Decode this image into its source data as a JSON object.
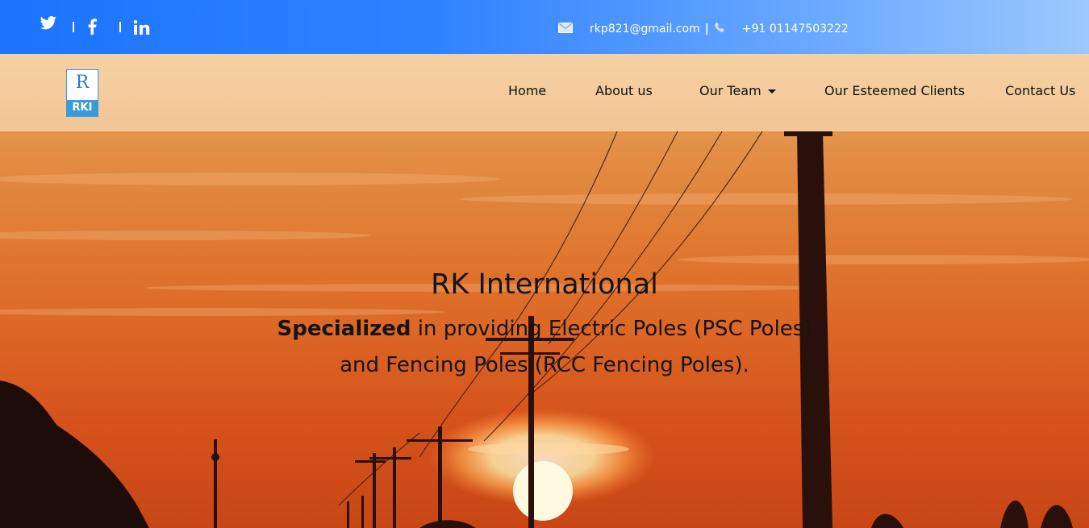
{
  "topbar": {
    "social": [
      {
        "name": "twitter-icon"
      },
      {
        "name": "facebook-icon"
      },
      {
        "name": "linkedin-icon"
      }
    ],
    "email": "rkp821@gmail.com",
    "separator": "|",
    "phone": "+91 01147503222",
    "email_icon": "envelope-icon",
    "phone_icon": "phone-icon"
  },
  "logo": {
    "letter": "R",
    "text": "RKI"
  },
  "nav": {
    "items": [
      "Home",
      "About us",
      "Our Team",
      "Our Esteemed Clients",
      "Contact Us"
    ]
  },
  "hero": {
    "title": "RK International",
    "line1_bold": "Specialized",
    "line1_rest": " in providing Electric Poles (PSC Poles)",
    "line2": "and Fencing Poles (RCC Fencing Poles)."
  },
  "colors": {
    "topbar_start": "#1c74ff",
    "topbar_end": "#9cc8ff",
    "logo_blue": "#3b9bd9",
    "sky_top": "#e7a35b",
    "sky_bottom": "#d44a16"
  }
}
